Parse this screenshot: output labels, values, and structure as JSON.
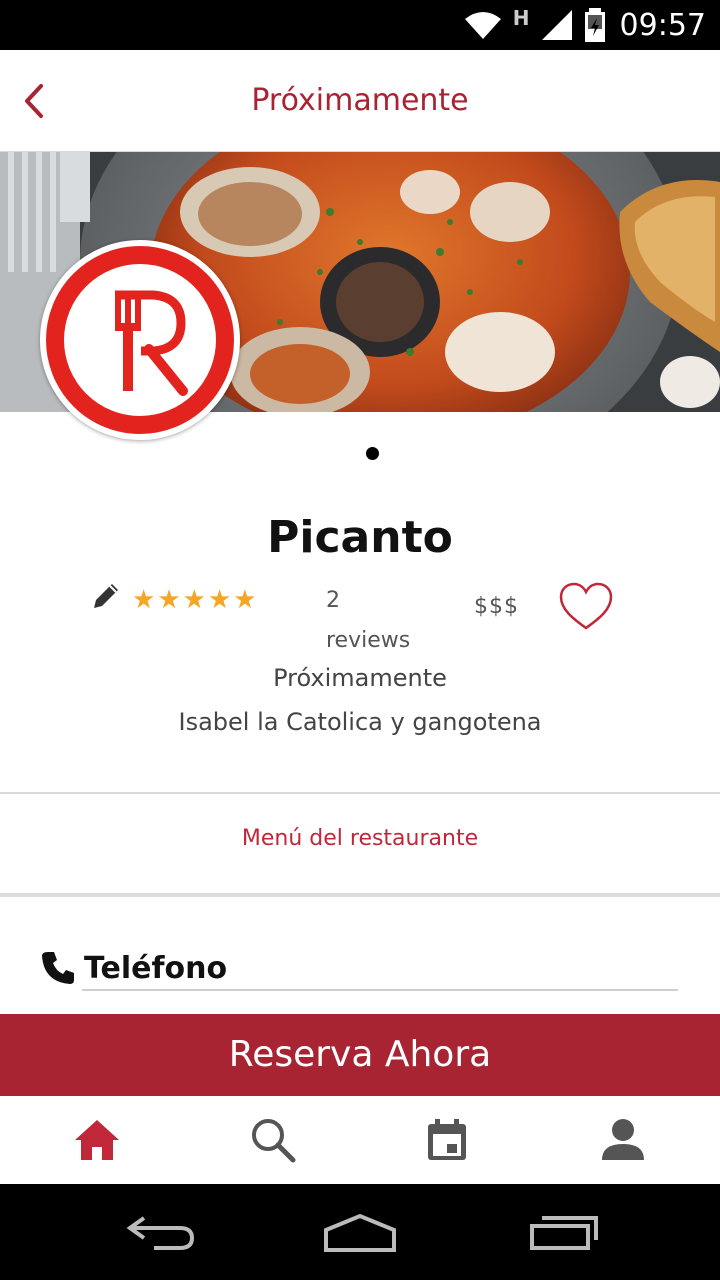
{
  "status_bar": {
    "time": "09:57",
    "network_label": "H"
  },
  "header": {
    "title": "Próximamente"
  },
  "hero": {
    "carousel_pages": 1,
    "active_page": 1
  },
  "restaurant": {
    "name": "Picanto",
    "rating": 5,
    "rating_max": 5,
    "reviews_count": "2",
    "reviews_label": "reviews",
    "price_level": "$$$",
    "status": "Próximamente",
    "address": "Isabel la Catolica y gangotena"
  },
  "menu_link": "Menú del restaurante",
  "phone": {
    "label": "Teléfono"
  },
  "cta": {
    "label": "Reserva Ahora"
  },
  "bottom_nav": {
    "items": [
      {
        "icon": "home-icon",
        "active": true
      },
      {
        "icon": "search-icon",
        "active": false
      },
      {
        "icon": "calendar-icon",
        "active": false
      },
      {
        "icon": "profile-icon",
        "active": false
      }
    ]
  },
  "colors": {
    "brand": "#a82433",
    "accent_link": "#c0283a",
    "star": "#f5a623",
    "logo_red": "#e3231e"
  }
}
